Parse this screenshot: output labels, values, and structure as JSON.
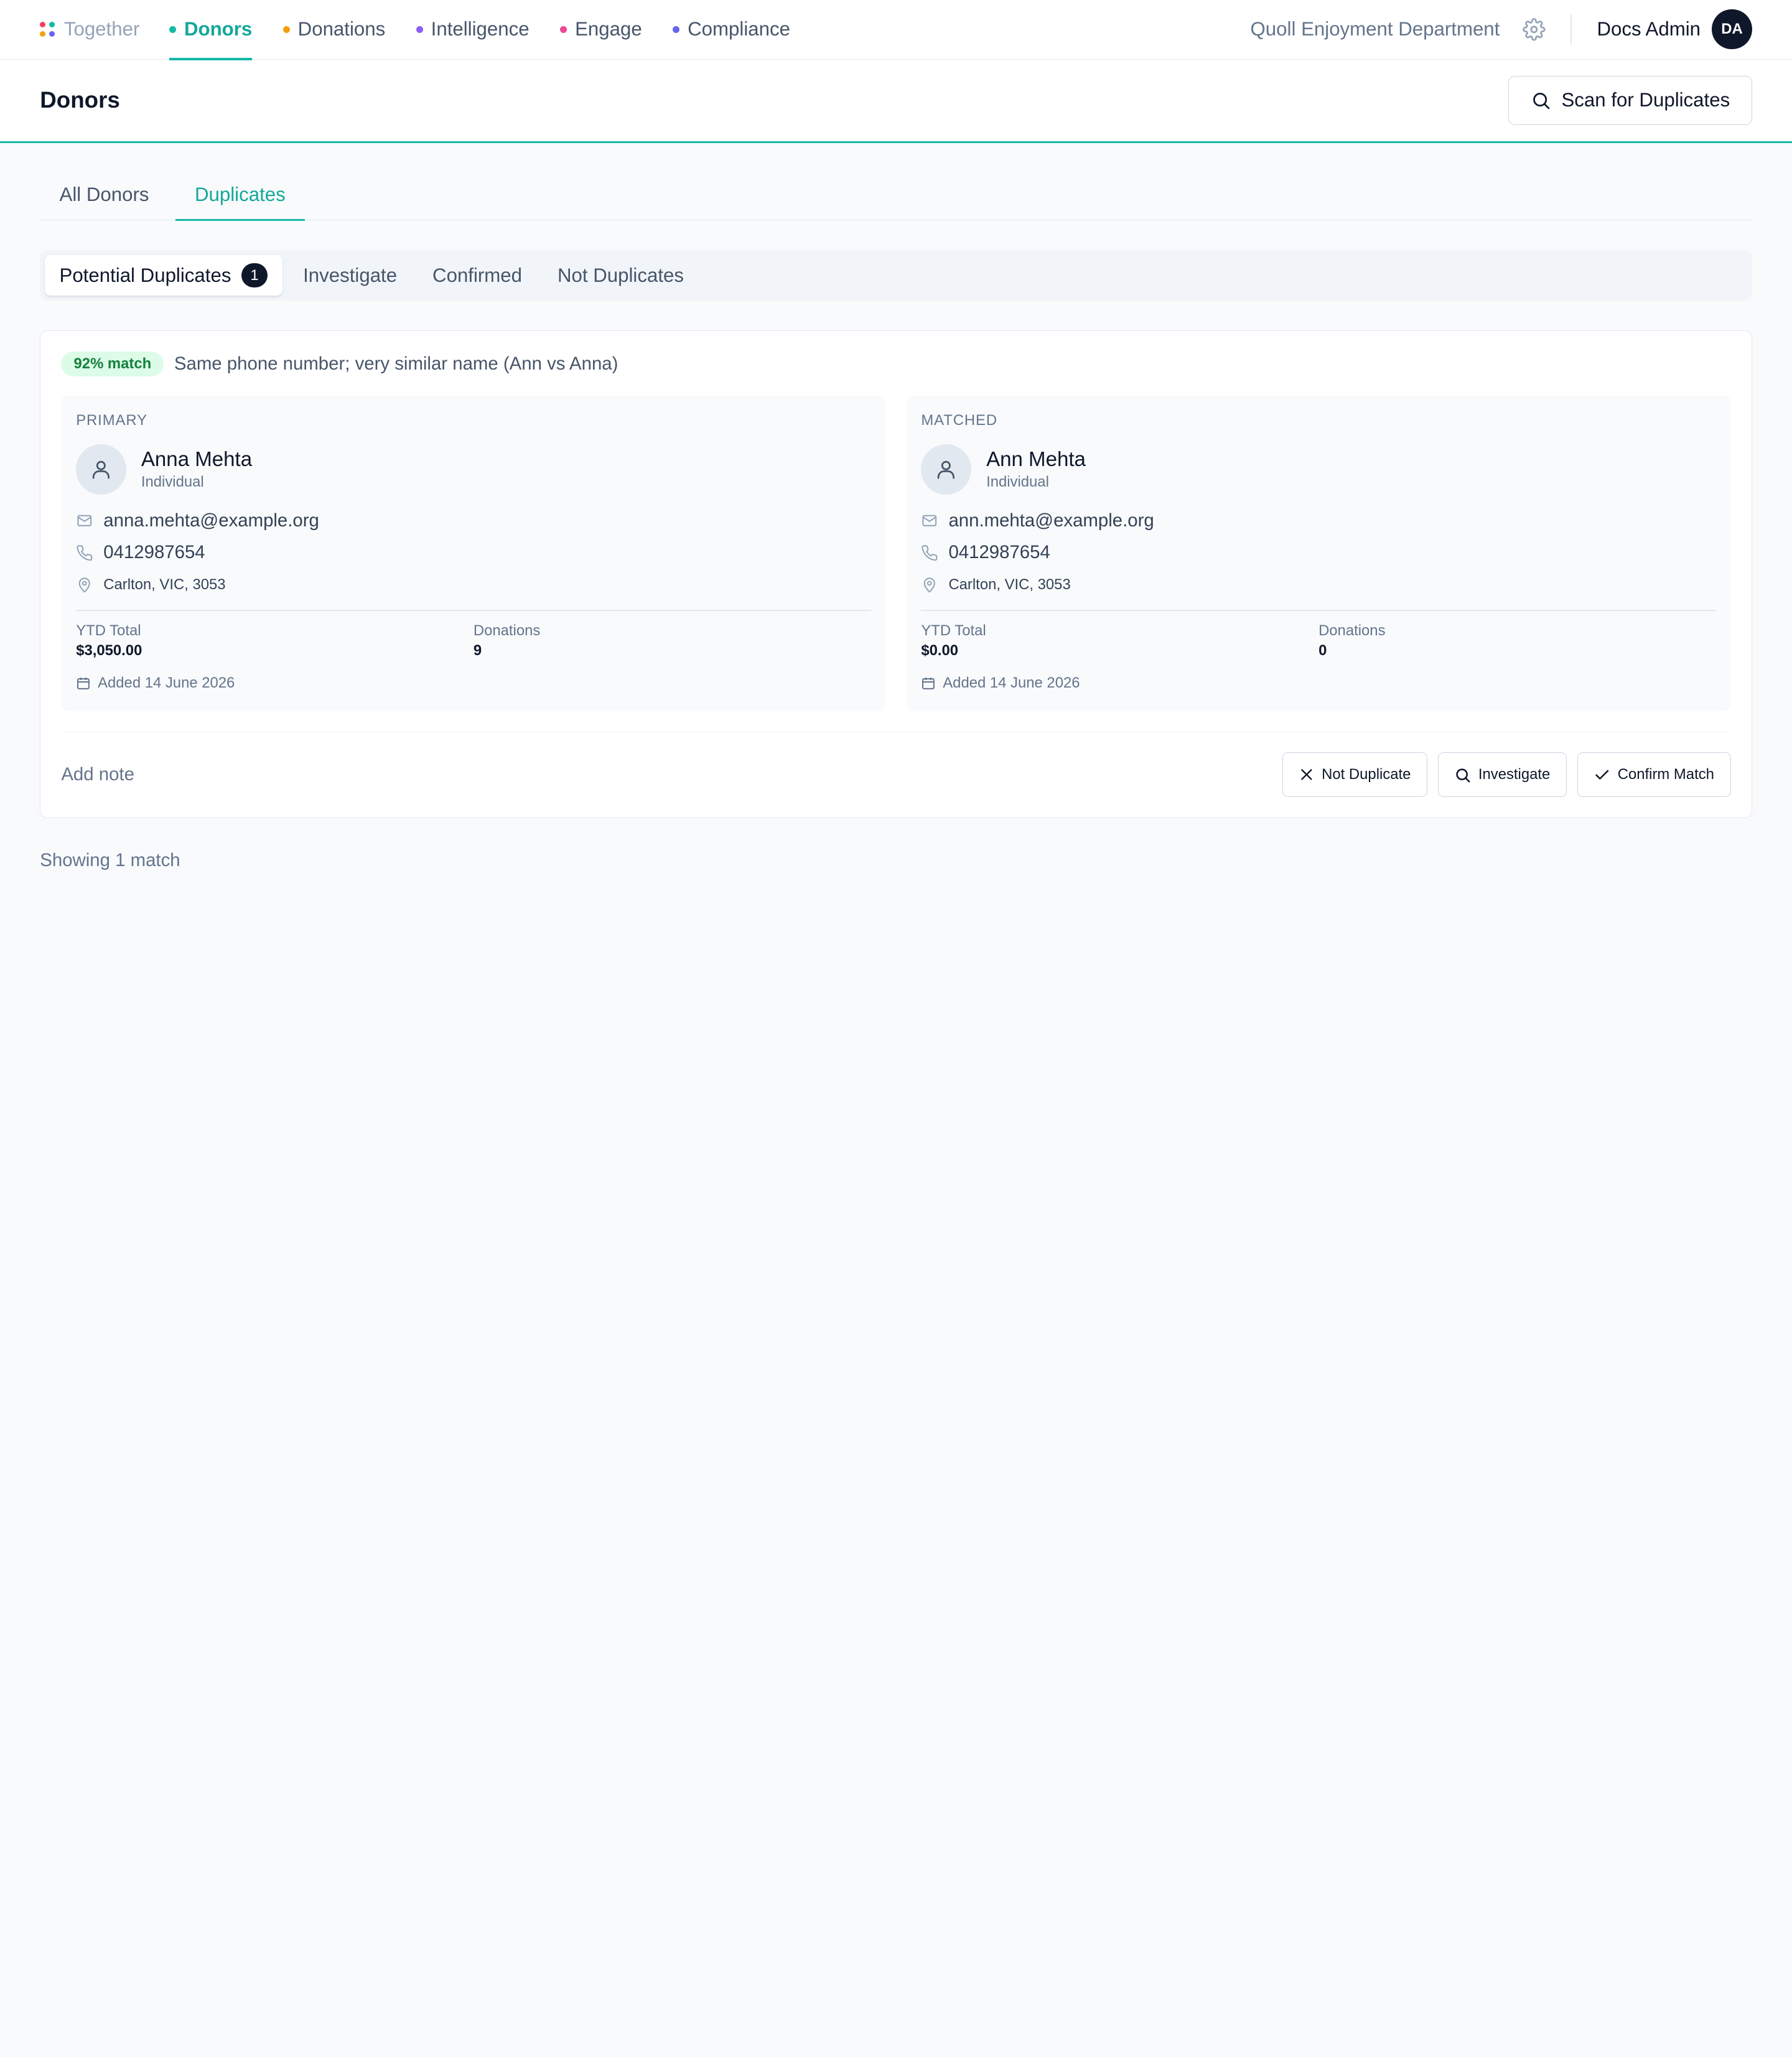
{
  "brand": {
    "name": "Together",
    "logo_colors": [
      "#f43f5e",
      "#14b8a6",
      "#f59e0b",
      "#6366f1"
    ]
  },
  "nav": {
    "items": [
      {
        "label": "Donors",
        "color": "#14b8a6",
        "active": true
      },
      {
        "label": "Donations",
        "color": "#f59e0b",
        "active": false
      },
      {
        "label": "Intelligence",
        "color": "#8b5cf6",
        "active": false
      },
      {
        "label": "Engage",
        "color": "#ec4899",
        "active": false
      },
      {
        "label": "Compliance",
        "color": "#6366f1",
        "active": false
      }
    ],
    "org_name": "Quoll Enjoyment Department",
    "user_name": "Docs Admin",
    "user_initials": "DA"
  },
  "header": {
    "title": "Donors",
    "scan_button": "Scan for Duplicates"
  },
  "main_tabs": [
    {
      "label": "All Donors",
      "active": false
    },
    {
      "label": "Duplicates",
      "active": true
    }
  ],
  "sub_tabs": [
    {
      "label": "Potential Duplicates",
      "badge": "1",
      "active": true
    },
    {
      "label": "Investigate",
      "active": false
    },
    {
      "label": "Confirmed",
      "active": false
    },
    {
      "label": "Not Duplicates",
      "active": false
    }
  ],
  "match": {
    "score": "92% match",
    "reason": "Same phone number; very similar name (Ann vs Anna)",
    "primary": {
      "label": "PRIMARY",
      "name": "Anna Mehta",
      "type": "Individual",
      "email": "anna.mehta@example.org",
      "phone": "0412987654",
      "address": "Carlton, VIC, 3053",
      "ytd_label": "YTD Total",
      "ytd_value": "$3,050.00",
      "donations_label": "Donations",
      "donations_value": "9",
      "added": "Added 14 June 2026"
    },
    "matched": {
      "label": "MATCHED",
      "name": "Ann Mehta",
      "type": "Individual",
      "email": "ann.mehta@example.org",
      "phone": "0412987654",
      "address": "Carlton, VIC, 3053",
      "ytd_label": "YTD Total",
      "ytd_value": "$0.00",
      "donations_label": "Donations",
      "donations_value": "0",
      "added": "Added 14 June 2026"
    },
    "add_note": "Add note",
    "actions": {
      "not_duplicate": "Not Duplicate",
      "investigate": "Investigate",
      "confirm": "Confirm Match"
    }
  },
  "footer": {
    "showing": "Showing 1 match"
  }
}
